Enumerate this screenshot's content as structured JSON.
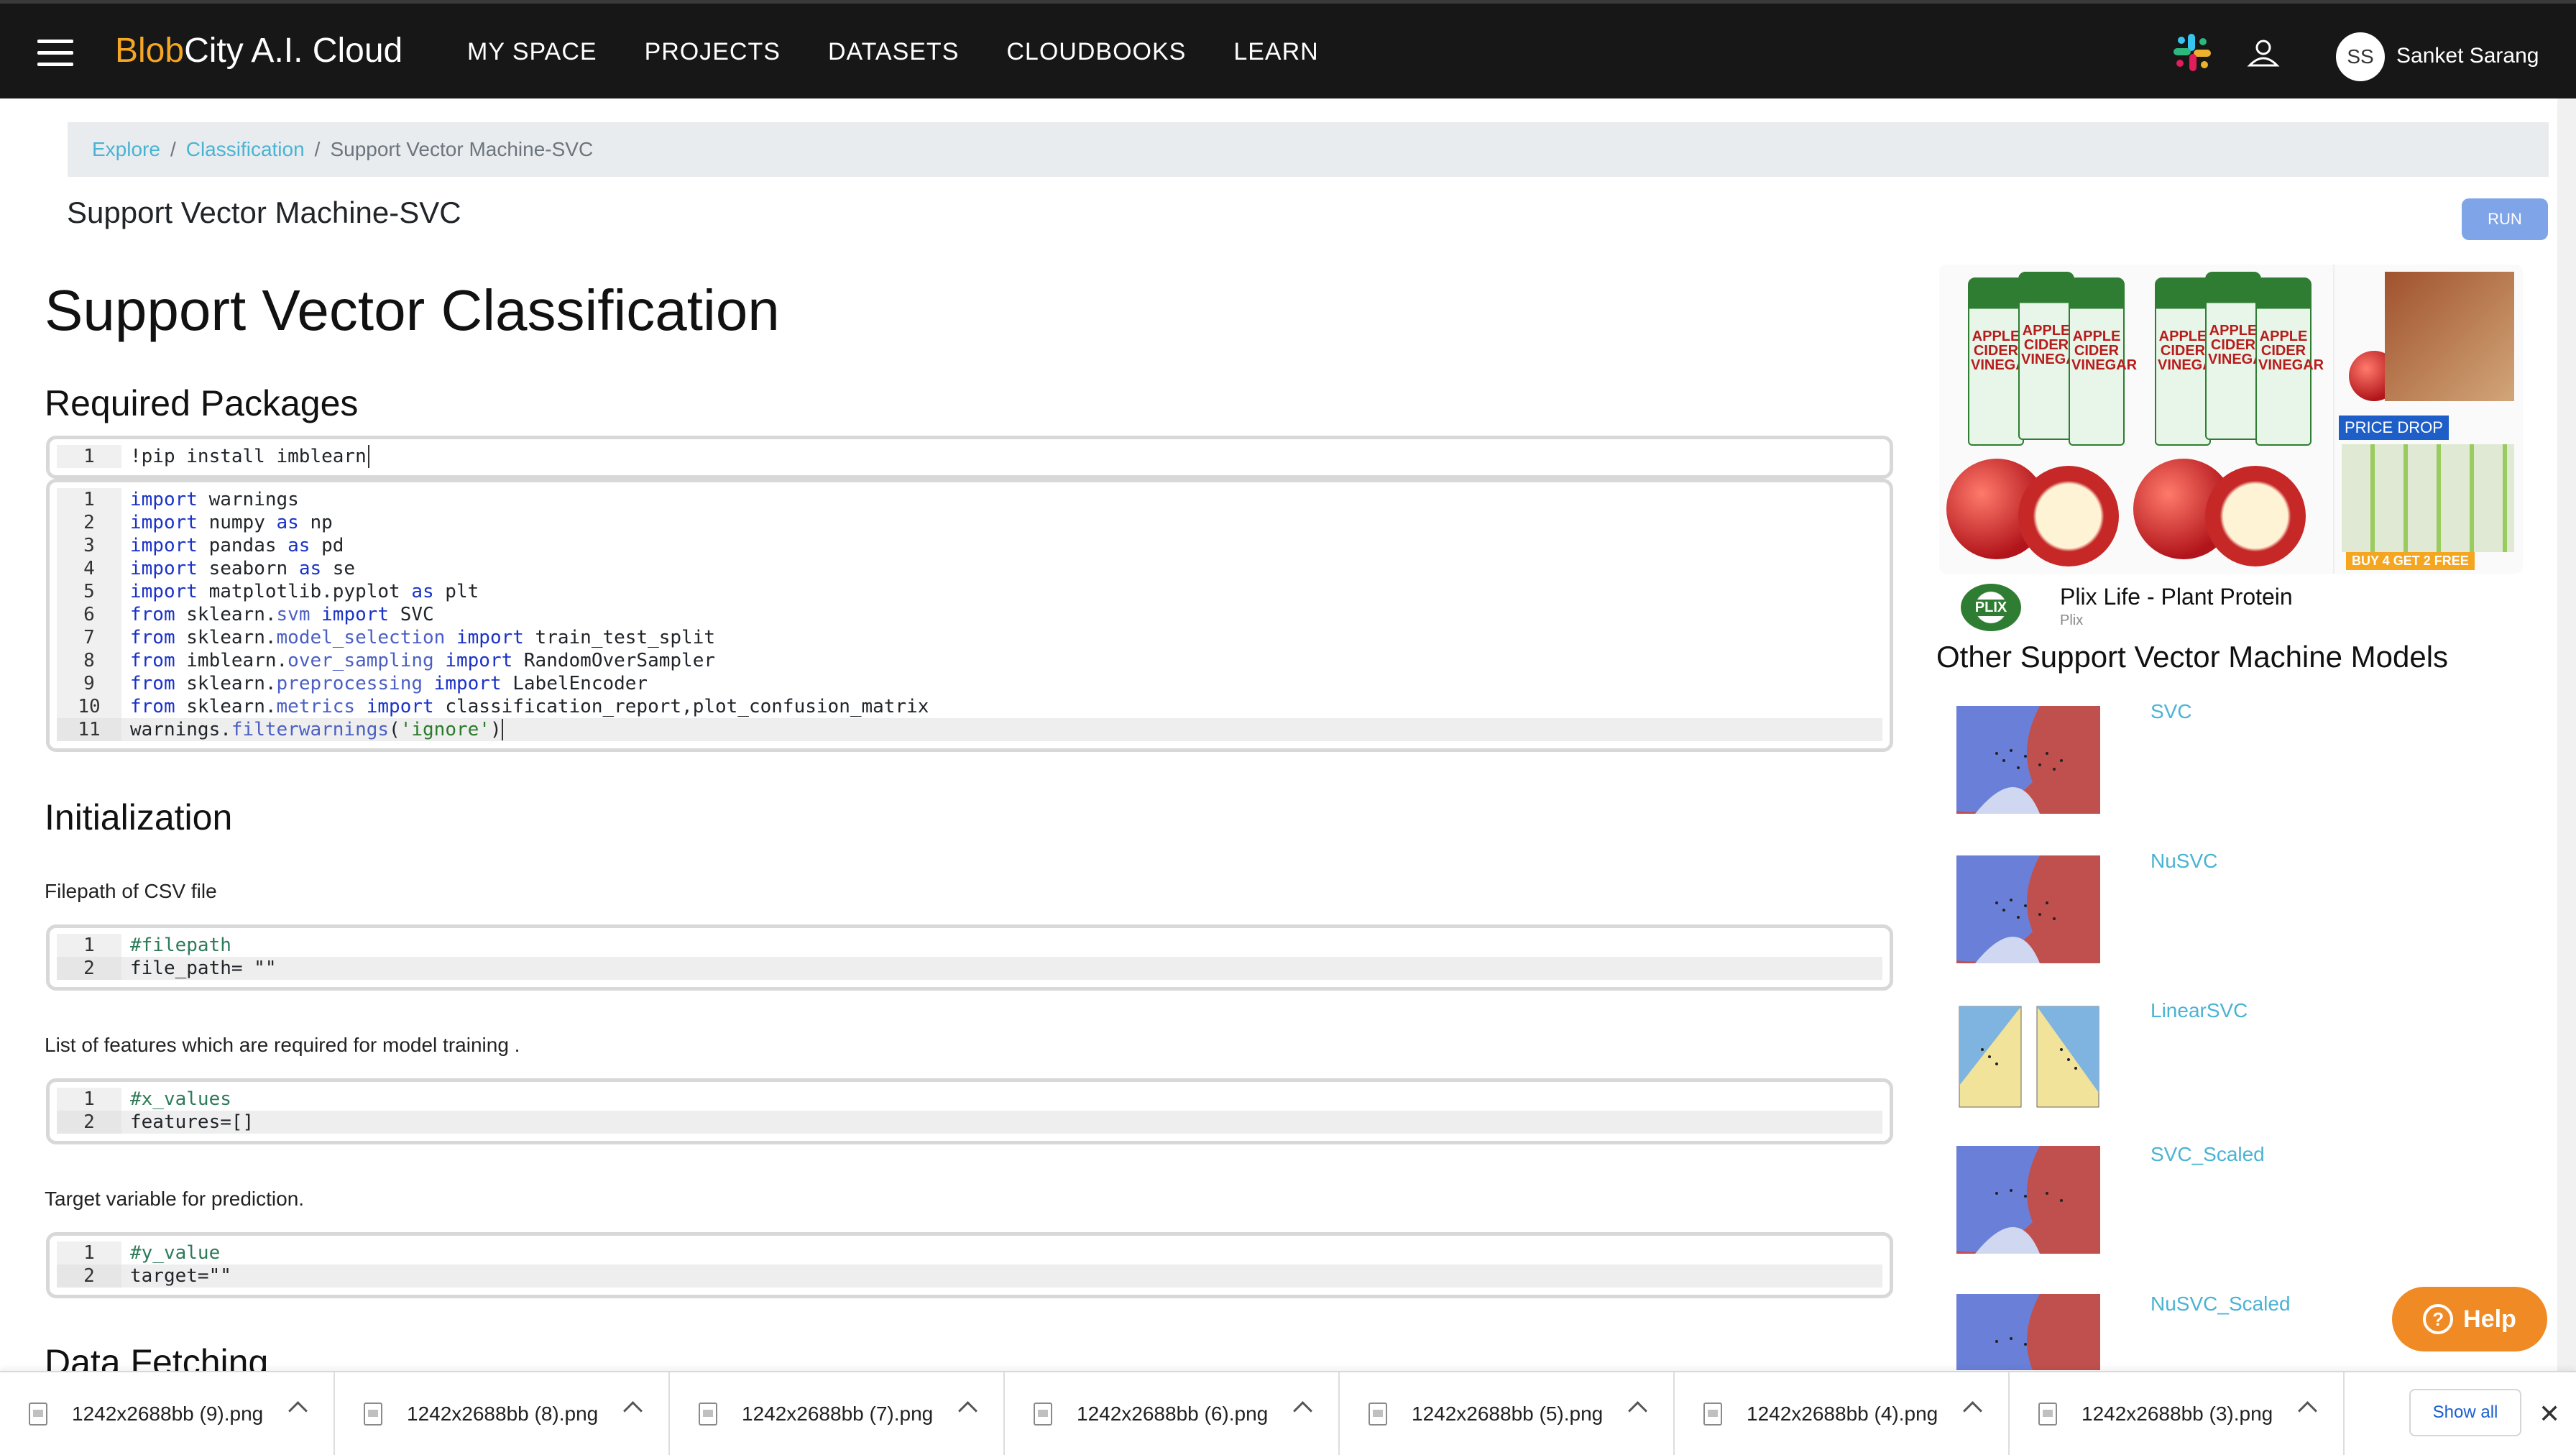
{
  "nav": {
    "brand_accent": "Blob",
    "brand_rest": "City A.I. Cloud",
    "items": [
      "MY SPACE",
      "PROJECTS",
      "DATASETS",
      "CLOUDBOOKS",
      "LEARN"
    ],
    "user_initials": "SS",
    "user_name": "Sanket Sarang"
  },
  "breadcrumb": {
    "items": [
      "Explore",
      "Classification",
      "Support Vector Machine-SVC"
    ]
  },
  "page": {
    "subtitle": "Support Vector Machine-SVC",
    "run_label": "RUN"
  },
  "content": {
    "title": "Support Vector Classification",
    "sections": {
      "packages": "Required Packages",
      "init": "Initialization",
      "fetch": "Data Fetching"
    },
    "paras": {
      "filepath": "Filepath of CSV file",
      "features": "List of features which are required for model training .",
      "target": "Target variable for prediction."
    },
    "cells": {
      "pip": [
        "!pip install imblearn"
      ],
      "imports": [
        "import warnings",
        "import numpy as np",
        "import pandas as pd",
        "import seaborn as se",
        "import matplotlib.pyplot as plt",
        "from sklearn.svm import SVC",
        "from sklearn.model_selection import train_test_split",
        "from imblearn.over_sampling import RandomOverSampler",
        "from sklearn.preprocessing import LabelEncoder",
        "from sklearn.metrics import classification_report,plot_confusion_matrix",
        "warnings.filterwarnings('ignore')"
      ],
      "filepath": [
        "#filepath",
        "file_path= \"\""
      ],
      "features": [
        "#x_values",
        "features=[]"
      ],
      "target": [
        "#y_value",
        "target=\"\""
      ]
    }
  },
  "ad": {
    "title": "Plix Life - Plant Protein",
    "brand": "Plix",
    "badge": "PRICE DROP",
    "offer": "BUY 4 GET 2 FREE",
    "logo": "PLIX",
    "bottle_text": "APPLE CIDER VINEGAR"
  },
  "sidebar": {
    "title": "Other Support Vector Machine Models",
    "models": [
      "SVC",
      "NuSVC",
      "LinearSVC",
      "SVC_Scaled",
      "NuSVC_Scaled"
    ]
  },
  "help": {
    "label": "Help"
  },
  "downloads": {
    "files": [
      "1242x2688bb (9).png",
      "1242x2688bb (8).png",
      "1242x2688bb (7).png",
      "1242x2688bb (6).png",
      "1242x2688bb (5).png",
      "1242x2688bb (4).png",
      "1242x2688bb (3).png"
    ],
    "show_all": "Show all"
  },
  "colors": {
    "topbar": "#171717",
    "brand_accent": "#f5a623",
    "link": "#49b3d3",
    "keyword": "#1a32c8",
    "help": "#f08a24",
    "run_button": "#7fa5e8"
  }
}
